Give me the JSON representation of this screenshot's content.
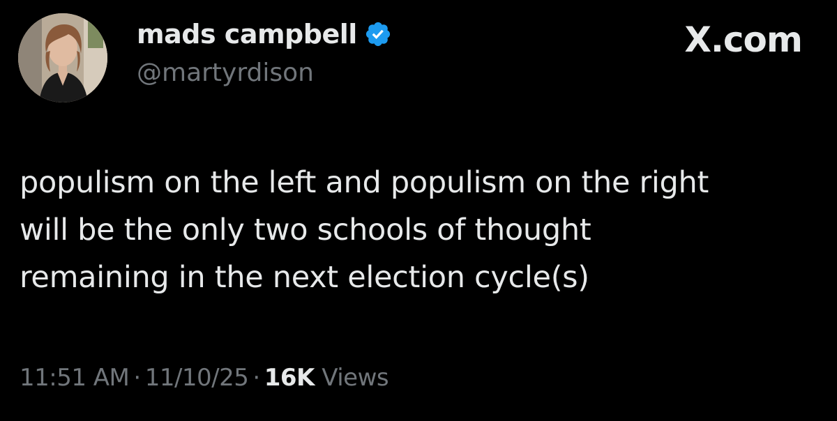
{
  "author": {
    "display_name": "mads campbell",
    "handle": "@martyrdison",
    "verified_icon": "verified-badge-icon",
    "verified_color": "#1d9bf0"
  },
  "brand": {
    "label": "X.com"
  },
  "tweet": {
    "text": "populism on the left and populism on the right\nwill be the only two schools of thought\nremaining in the next election cycle(s)"
  },
  "meta": {
    "time": "11:51 AM",
    "date": "11/10/25",
    "separator": "·",
    "views_count": "16K",
    "views_label": "Views"
  },
  "colors": {
    "background": "#000000",
    "primary_text": "#e7e9ea",
    "secondary_text": "#71767b"
  }
}
